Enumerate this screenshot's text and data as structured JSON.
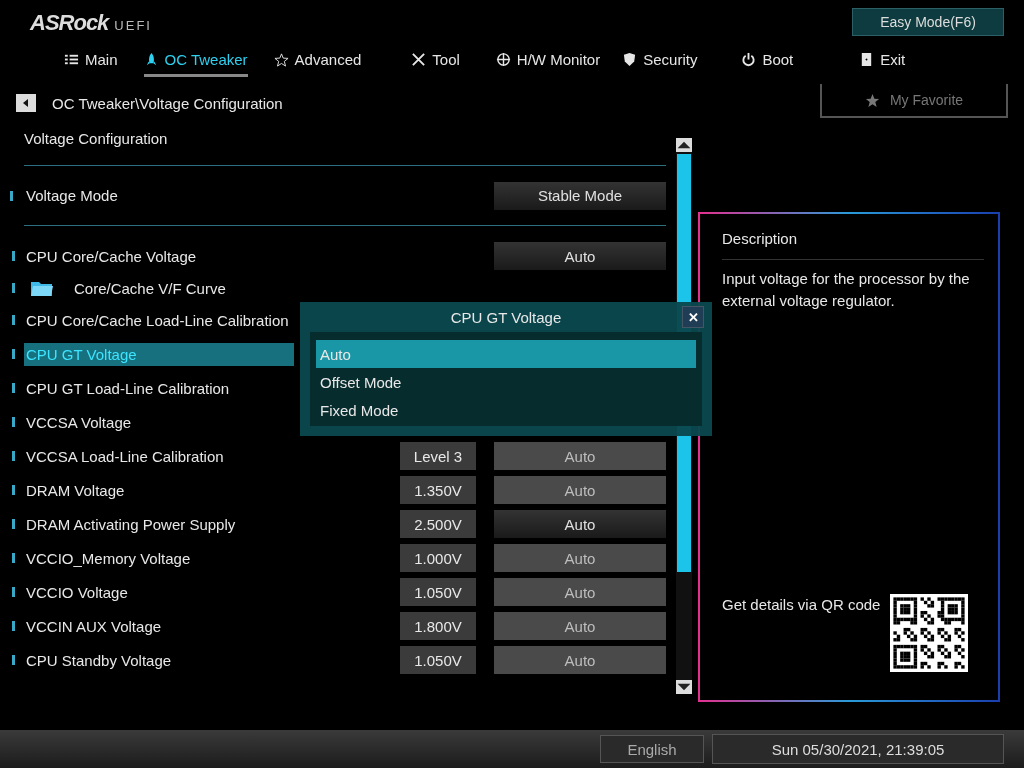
{
  "header": {
    "logo": "ASRock",
    "logo_suffix": "UEFI",
    "mode_button": "Easy Mode(F6)"
  },
  "tabs": [
    {
      "label": "Main",
      "selected": false
    },
    {
      "label": "OC Tweaker",
      "selected": true
    },
    {
      "label": "Advanced",
      "selected": false
    },
    {
      "label": "Tool",
      "selected": false
    },
    {
      "label": "H/W Monitor",
      "selected": false
    },
    {
      "label": "Security",
      "selected": false
    },
    {
      "label": "Boot",
      "selected": false
    },
    {
      "label": "Exit",
      "selected": false
    }
  ],
  "breadcrumb": "OC Tweaker\\Voltage Configuration",
  "favorite_button": "My Favorite",
  "section_title": "Voltage Configuration",
  "mode_row": {
    "label": "Voltage Mode",
    "option": "Stable Mode"
  },
  "rows": [
    {
      "kind": "setting",
      "label": "CPU Core/Cache Voltage",
      "option": "Auto",
      "disabled": false,
      "selected": false
    },
    {
      "kind": "folder",
      "label": "Core/Cache V/F Curve",
      "selected": false
    },
    {
      "kind": "setting",
      "label": "CPU Core/Cache Load-Line Calibration",
      "selected": false
    },
    {
      "kind": "setting",
      "label": "CPU GT Voltage",
      "selected": true
    },
    {
      "kind": "setting",
      "label": "CPU GT Load-Line Calibration",
      "selected": false
    },
    {
      "kind": "setting",
      "label": "VCCSA Voltage",
      "selected": false
    },
    {
      "kind": "setting",
      "label": "VCCSA Load-Line Calibration",
      "value": "Level 3",
      "option": "Auto",
      "disabled": true,
      "selected": false
    },
    {
      "kind": "setting",
      "label": "DRAM Voltage",
      "value": "1.350V",
      "option": "Auto",
      "disabled": true,
      "selected": false
    },
    {
      "kind": "setting",
      "label": "DRAM Activating Power Supply",
      "value": "2.500V",
      "option": "Auto",
      "disabled": false,
      "selected": false
    },
    {
      "kind": "setting",
      "label": "VCCIO_Memory Voltage",
      "value": "1.000V",
      "option": "Auto",
      "disabled": true,
      "selected": false
    },
    {
      "kind": "setting",
      "label": "VCCIO Voltage",
      "value": "1.050V",
      "option": "Auto",
      "disabled": true,
      "selected": false
    },
    {
      "kind": "setting",
      "label": "VCCIN AUX Voltage",
      "value": "1.800V",
      "option": "Auto",
      "disabled": true,
      "selected": false
    },
    {
      "kind": "setting",
      "label": "CPU Standby Voltage",
      "value": "1.050V",
      "option": "Auto",
      "disabled": true,
      "selected": false
    }
  ],
  "popup": {
    "title": "CPU GT Voltage",
    "close": "✕",
    "options": [
      {
        "label": "Auto",
        "selected": true
      },
      {
        "label": "Offset Mode",
        "selected": false
      },
      {
        "label": "Fixed Mode",
        "selected": false
      }
    ]
  },
  "description": {
    "title": "Description",
    "text": "Input voltage for the processor by the external voltage regulator.",
    "qr_text": "Get details via QR code"
  },
  "footer": {
    "language": "English",
    "datetime": "Sun 05/30/2021, 21:39:05"
  }
}
